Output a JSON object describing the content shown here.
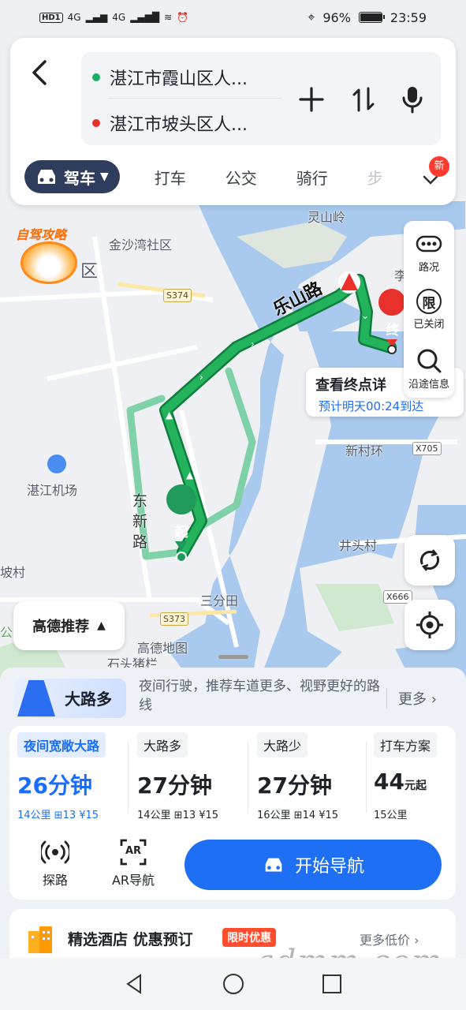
{
  "status": {
    "signal_text": "4G",
    "signal_text2": "4G",
    "hd": "HD",
    "hd_num": "1",
    "battery": "96%",
    "battery_level": 0.96,
    "time": "23:59"
  },
  "header": {
    "start": "湛江市霞山区人...",
    "end": "湛江市坡头区人...",
    "colors": {
      "start_dot": "#18b060",
      "end_dot": "#e8312a"
    }
  },
  "modes": {
    "active": "驾车",
    "items": [
      "打车",
      "公交",
      "骑行",
      "步"
    ],
    "badge": "新"
  },
  "map": {
    "labels": {
      "jinsha": "金沙湾社区",
      "qu": "区",
      "lingshanling": "灵山岭",
      "airport": "湛江机场",
      "dongxin": "东新路",
      "sanfentian": "三分田",
      "gaode": "高德地图",
      "shitou": "石头猪栏",
      "xincun": "新村环",
      "jingtou": "井头村",
      "pocun": "坡村",
      "li": "李",
      "gong": "公",
      "leshan": "乐山路"
    },
    "road_tags": {
      "s374": "S374",
      "s373": "S373",
      "x705": "X705",
      "x666": "X666"
    },
    "start_marker": "起",
    "end_marker": "终"
  },
  "self_drive": {
    "title": "自驾攻略"
  },
  "tools": {
    "traffic": "路况",
    "limit_icon": "限",
    "limit": "已关闭",
    "along": "沿途信息"
  },
  "dest_bubble": {
    "title": "查看终点详",
    "eta": "预计明天00:24到达"
  },
  "recommend": {
    "label": "高德推荐"
  },
  "tip": {
    "badge": "大路多",
    "desc": "夜间行驶，推荐车道更多、视野更好的路线",
    "more": "更多"
  },
  "routes": [
    {
      "tag": "夜间宽敞大路",
      "time": "26分钟",
      "meta": "14公里 ⊞13 ¥15",
      "selected": true
    },
    {
      "tag": "大路多",
      "time": "27分钟",
      "meta": "14公里 ⊞13 ¥15"
    },
    {
      "tag": "大路少",
      "time": "27分钟",
      "meta": "16公里 ⊞14 ¥15"
    },
    {
      "tag": "打车方案",
      "time": "44",
      "time_suffix": "元起",
      "meta": "15公里"
    }
  ],
  "actions": {
    "probe": "探路",
    "ar_icon": "AR",
    "ar": "AR导航",
    "start": "开始导航"
  },
  "hotel": {
    "title": "精选酒店 优惠预订",
    "limit": "限时优惠",
    "more": "更多低价"
  },
  "watermark": "gdmm.com"
}
